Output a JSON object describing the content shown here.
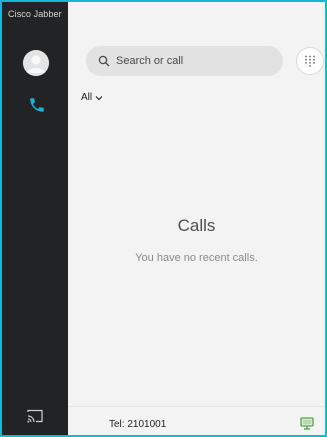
{
  "app": {
    "title": "Cisco Jabber"
  },
  "search": {
    "placeholder": "Search or call"
  },
  "filter": {
    "label": "All"
  },
  "empty_state": {
    "title": "Calls",
    "message": "You have no recent calls."
  },
  "status_bar": {
    "tel_label": "Tel: 2101001"
  },
  "icons": {
    "nav_phone": "phone-icon",
    "search": "search-icon",
    "dialpad": "dialpad-icon",
    "cast": "screen-cast-icon",
    "device": "desktop-monitor-icon"
  },
  "colors": {
    "window_border": "#19b5d6",
    "sidebar_bg": "#212325",
    "accent_phone": "#1bb0d6",
    "device_green": "#4ca63c"
  }
}
